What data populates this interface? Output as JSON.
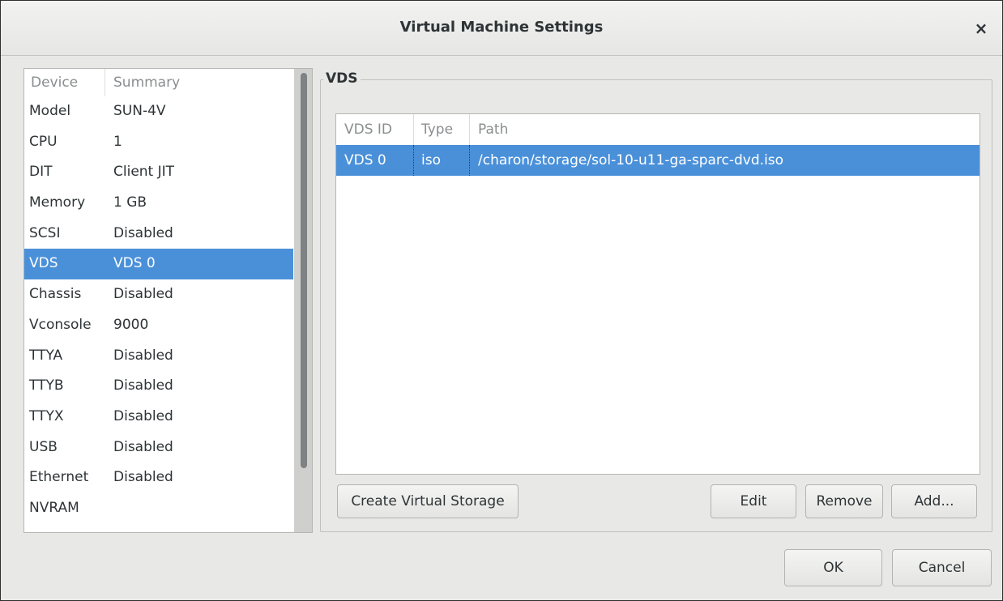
{
  "window": {
    "title": "Virtual Machine Settings",
    "close_glyph": "×"
  },
  "devices": {
    "headers": {
      "device": "Device",
      "summary": "Summary"
    },
    "rows": [
      {
        "device": "Model",
        "summary": "SUN-4V"
      },
      {
        "device": "CPU",
        "summary": "1"
      },
      {
        "device": "DIT",
        "summary": "Client JIT"
      },
      {
        "device": "Memory",
        "summary": "1 GB"
      },
      {
        "device": "SCSI",
        "summary": "Disabled"
      },
      {
        "device": "VDS",
        "summary": "VDS 0"
      },
      {
        "device": "Chassis",
        "summary": "Disabled"
      },
      {
        "device": "Vconsole",
        "summary": "9000"
      },
      {
        "device": "TTYA",
        "summary": "Disabled"
      },
      {
        "device": "TTYB",
        "summary": "Disabled"
      },
      {
        "device": "TTYX",
        "summary": "Disabled"
      },
      {
        "device": "USB",
        "summary": "Disabled"
      },
      {
        "device": "Ethernet",
        "summary": "Disabled"
      },
      {
        "device": "NVRAM",
        "summary": ""
      }
    ],
    "selected": "VDS"
  },
  "vds": {
    "frame_label": "VDS",
    "headers": {
      "id": "VDS ID",
      "type": "Type",
      "path": "Path"
    },
    "rows": [
      {
        "id": "VDS 0",
        "type": "iso",
        "path": "/charon/storage/sol-10-u11-ga-sparc-dvd.iso"
      }
    ],
    "buttons": {
      "create": "Create Virtual Storage",
      "edit": "Edit",
      "remove": "Remove",
      "add": "Add..."
    }
  },
  "dialog": {
    "ok": "OK",
    "cancel": "Cancel"
  },
  "colors": {
    "selection": "#4a90d9",
    "window_bg": "#e8e8e7"
  }
}
